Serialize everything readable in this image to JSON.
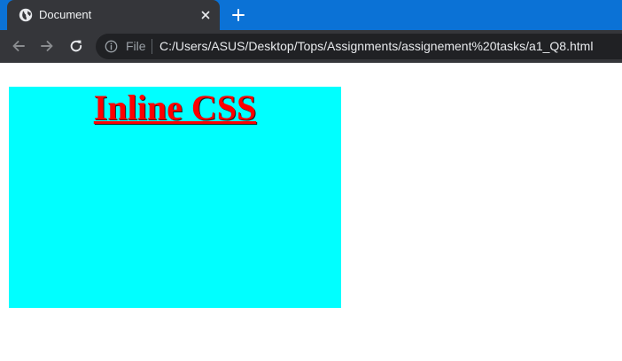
{
  "browser": {
    "tab_title": "Document",
    "omnibox_scheme": "File",
    "url": "C:/Users/ASUS/Desktop/Tops/Assignments/assignement%20tasks/a1_Q8.html"
  },
  "page": {
    "heading": "Inline CSS",
    "box_color": "#00ffff",
    "heading_color": "#ff0000"
  },
  "icons": {
    "tab_favicon": "globe-icon",
    "tab_close": "close-icon",
    "new_tab": "plus-icon",
    "back": "arrow-left-icon",
    "forward": "arrow-right-icon",
    "reload": "reload-icon",
    "site_info": "info-icon"
  }
}
